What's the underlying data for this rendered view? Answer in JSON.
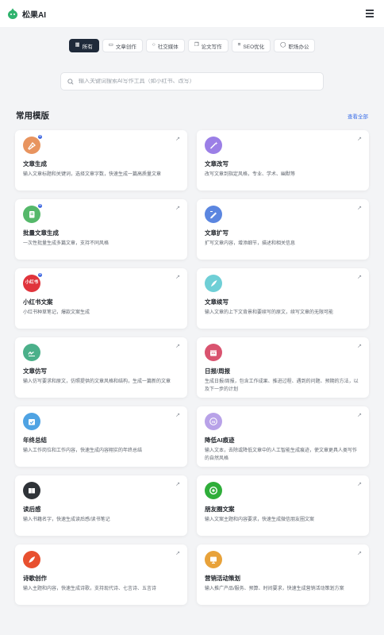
{
  "header": {
    "brand": "松果AI"
  },
  "tabs": [
    {
      "label": "所有",
      "icon": "grid-icon",
      "active": true
    },
    {
      "label": "文章创作",
      "icon": "folder-icon",
      "active": false
    },
    {
      "label": "社交媒体",
      "icon": "chat-icon",
      "active": false
    },
    {
      "label": "论文写作",
      "icon": "copy-icon",
      "active": false
    },
    {
      "label": "SEO优化",
      "icon": "list-icon",
      "active": false
    },
    {
      "label": "职场办公",
      "icon": "user-icon",
      "active": false
    }
  ],
  "search": {
    "placeholder": "输入关键词搜索AI写作工具（如小红书、改写）"
  },
  "section": {
    "title": "常用模版",
    "view_all": "查看全部"
  },
  "cards": [
    {
      "title": "文章生成",
      "desc": "输入文章标题和关键词，选择文章字数，快速生成一篇高质量文章",
      "icon": "pen-nib-icon",
      "color": "#e8945f",
      "badge": true
    },
    {
      "title": "文章改写",
      "desc": "改写文章到指定风格，专业、学术、幽默等",
      "icon": "magic-wand-icon",
      "color": "#9b7fe6",
      "badge": false
    },
    {
      "title": "批量文章生成",
      "desc": "一次性批量生成多篇文章，支持不同风格",
      "icon": "document-stack-icon",
      "color": "#55b86a",
      "badge": true
    },
    {
      "title": "文章扩写",
      "desc": "扩写文章内容，增添细节，描述和相关信息",
      "icon": "pencil-expand-icon",
      "color": "#5b86e0",
      "badge": false
    },
    {
      "title": "小红书文案",
      "desc": "小红书种草笔记，爆款文案生成",
      "icon": "xiaohongshu-icon",
      "color": "#e0343c",
      "badge": true
    },
    {
      "title": "文章续写",
      "desc": "输入文章的上下文背景和要续写的原文，续写文章的无限可能",
      "icon": "quill-icon",
      "color": "#6fcfd6",
      "badge": false
    },
    {
      "title": "文章仿写",
      "desc": "输入仿写要求和原文，仿照提供的文章风格和结构，生成一篇新的文章",
      "icon": "signature-icon",
      "color": "#4bb08a",
      "badge": false
    },
    {
      "title": "日报/周报",
      "desc": "生成日报/周报，包含工作成果、推进过程、遇到的问题、预期的方法，以及下一步的计划",
      "icon": "calendar-icon",
      "color": "#d9536f",
      "badge": false
    },
    {
      "title": "年终总结",
      "desc": "输入工作岗位和工作内容，快速生成内容翔实的年终总结",
      "icon": "calendar-check-icon",
      "color": "#4fa3e3",
      "badge": false
    },
    {
      "title": "降低AI痕迹",
      "desc": "输入文本，去除或降低文章中的人工智能生成痕迹，使文章更具人类写作的自然风格",
      "icon": "ai-icon",
      "color": "#b8a2e8",
      "badge": false
    },
    {
      "title": "读后感",
      "desc": "输入书籍名字，快速生成读后感/读书笔记",
      "icon": "book-icon",
      "color": "#2f3338",
      "badge": false
    },
    {
      "title": "朋友圈文案",
      "desc": "输入文案主题和内容要求，快速生成微信朋友圈文案",
      "icon": "camera-aperture-icon",
      "color": "#2fae3a",
      "badge": false
    },
    {
      "title": "诗歌创作",
      "desc": "输入主题和内容，快速生成诗歌，支持现代诗、七言诗、五言诗",
      "icon": "feather-icon",
      "color": "#e8502f",
      "badge": false
    },
    {
      "title": "营销活动策划",
      "desc": "输入推广产品/服务、预算、时间要求，快速生成营销活动策划方案",
      "icon": "presentation-icon",
      "color": "#e8a23a",
      "badge": false
    }
  ]
}
